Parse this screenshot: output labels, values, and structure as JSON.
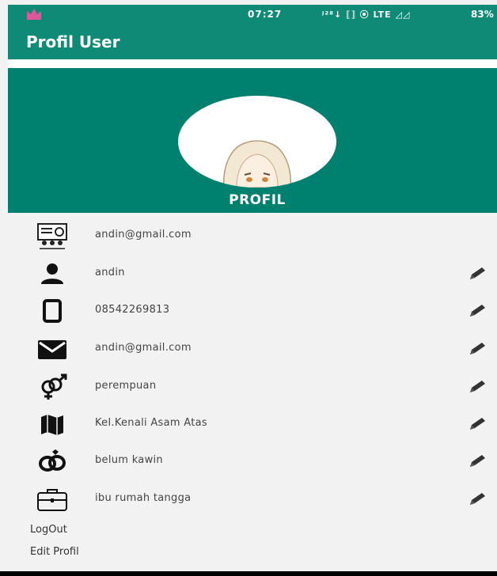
{
  "status_bar": {
    "time": "07:27",
    "icons": "ʲ²⁸↓ ⟦⟧ ⦿ LTE ◿◿",
    "battery": "83%"
  },
  "app_bar": {
    "title": "Profil User"
  },
  "header": {
    "label": "PROFIL"
  },
  "fields": [
    {
      "icon": "contact-card-icon",
      "value": "andin@gmail.com",
      "editable": false
    },
    {
      "icon": "person-icon",
      "value": "andin",
      "editable": true
    },
    {
      "icon": "phone-icon",
      "value": "08542269813",
      "editable": true
    },
    {
      "icon": "mail-icon",
      "value": "andin@gmail.com",
      "editable": true
    },
    {
      "icon": "gender-icon",
      "value": "perempuan",
      "editable": true
    },
    {
      "icon": "map-icon",
      "value": "Kel.Kenali Asam Atas",
      "editable": true
    },
    {
      "icon": "rings-icon",
      "value": "belum kawin",
      "editable": true
    },
    {
      "icon": "briefcase-icon",
      "value": "ibu rumah tangga",
      "editable": true
    }
  ],
  "actions": {
    "logout": "LogOut",
    "edit_profile": "Edit Profil"
  },
  "colors": {
    "primary": "#0f8a77",
    "header": "#00806f",
    "background": "#f2f2f2"
  }
}
